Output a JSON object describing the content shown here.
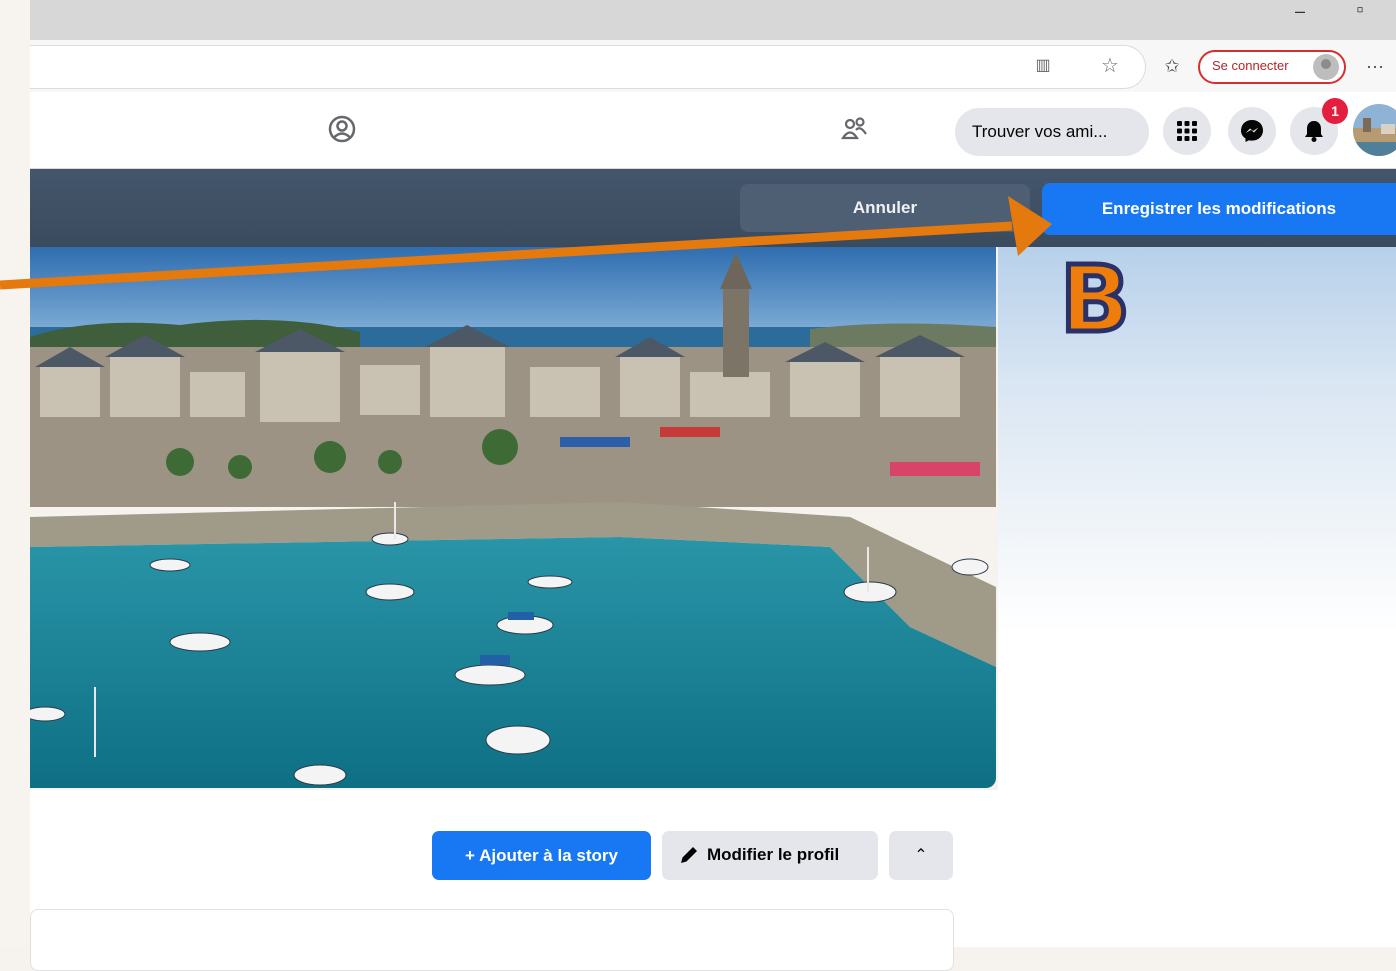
{
  "browser": {
    "signin_label": "Se connecter",
    "more_label": "···"
  },
  "facebook": {
    "find_friends_label": "Trouver vos ami...",
    "notification_count": "1"
  },
  "edit_bar": {
    "cancel_label": "Annuler",
    "save_label": "Enregistrer les modifications"
  },
  "annotation": {
    "label": "B",
    "color": "#ef7d0c"
  },
  "profile_actions": {
    "add_story_label": "+ Ajouter à la story",
    "edit_profile_label": "Modifier le profil"
  },
  "colors": {
    "facebook_blue": "#1877f2",
    "edit_bar": "#3b4b5e",
    "notification_red": "#e41e3f"
  }
}
